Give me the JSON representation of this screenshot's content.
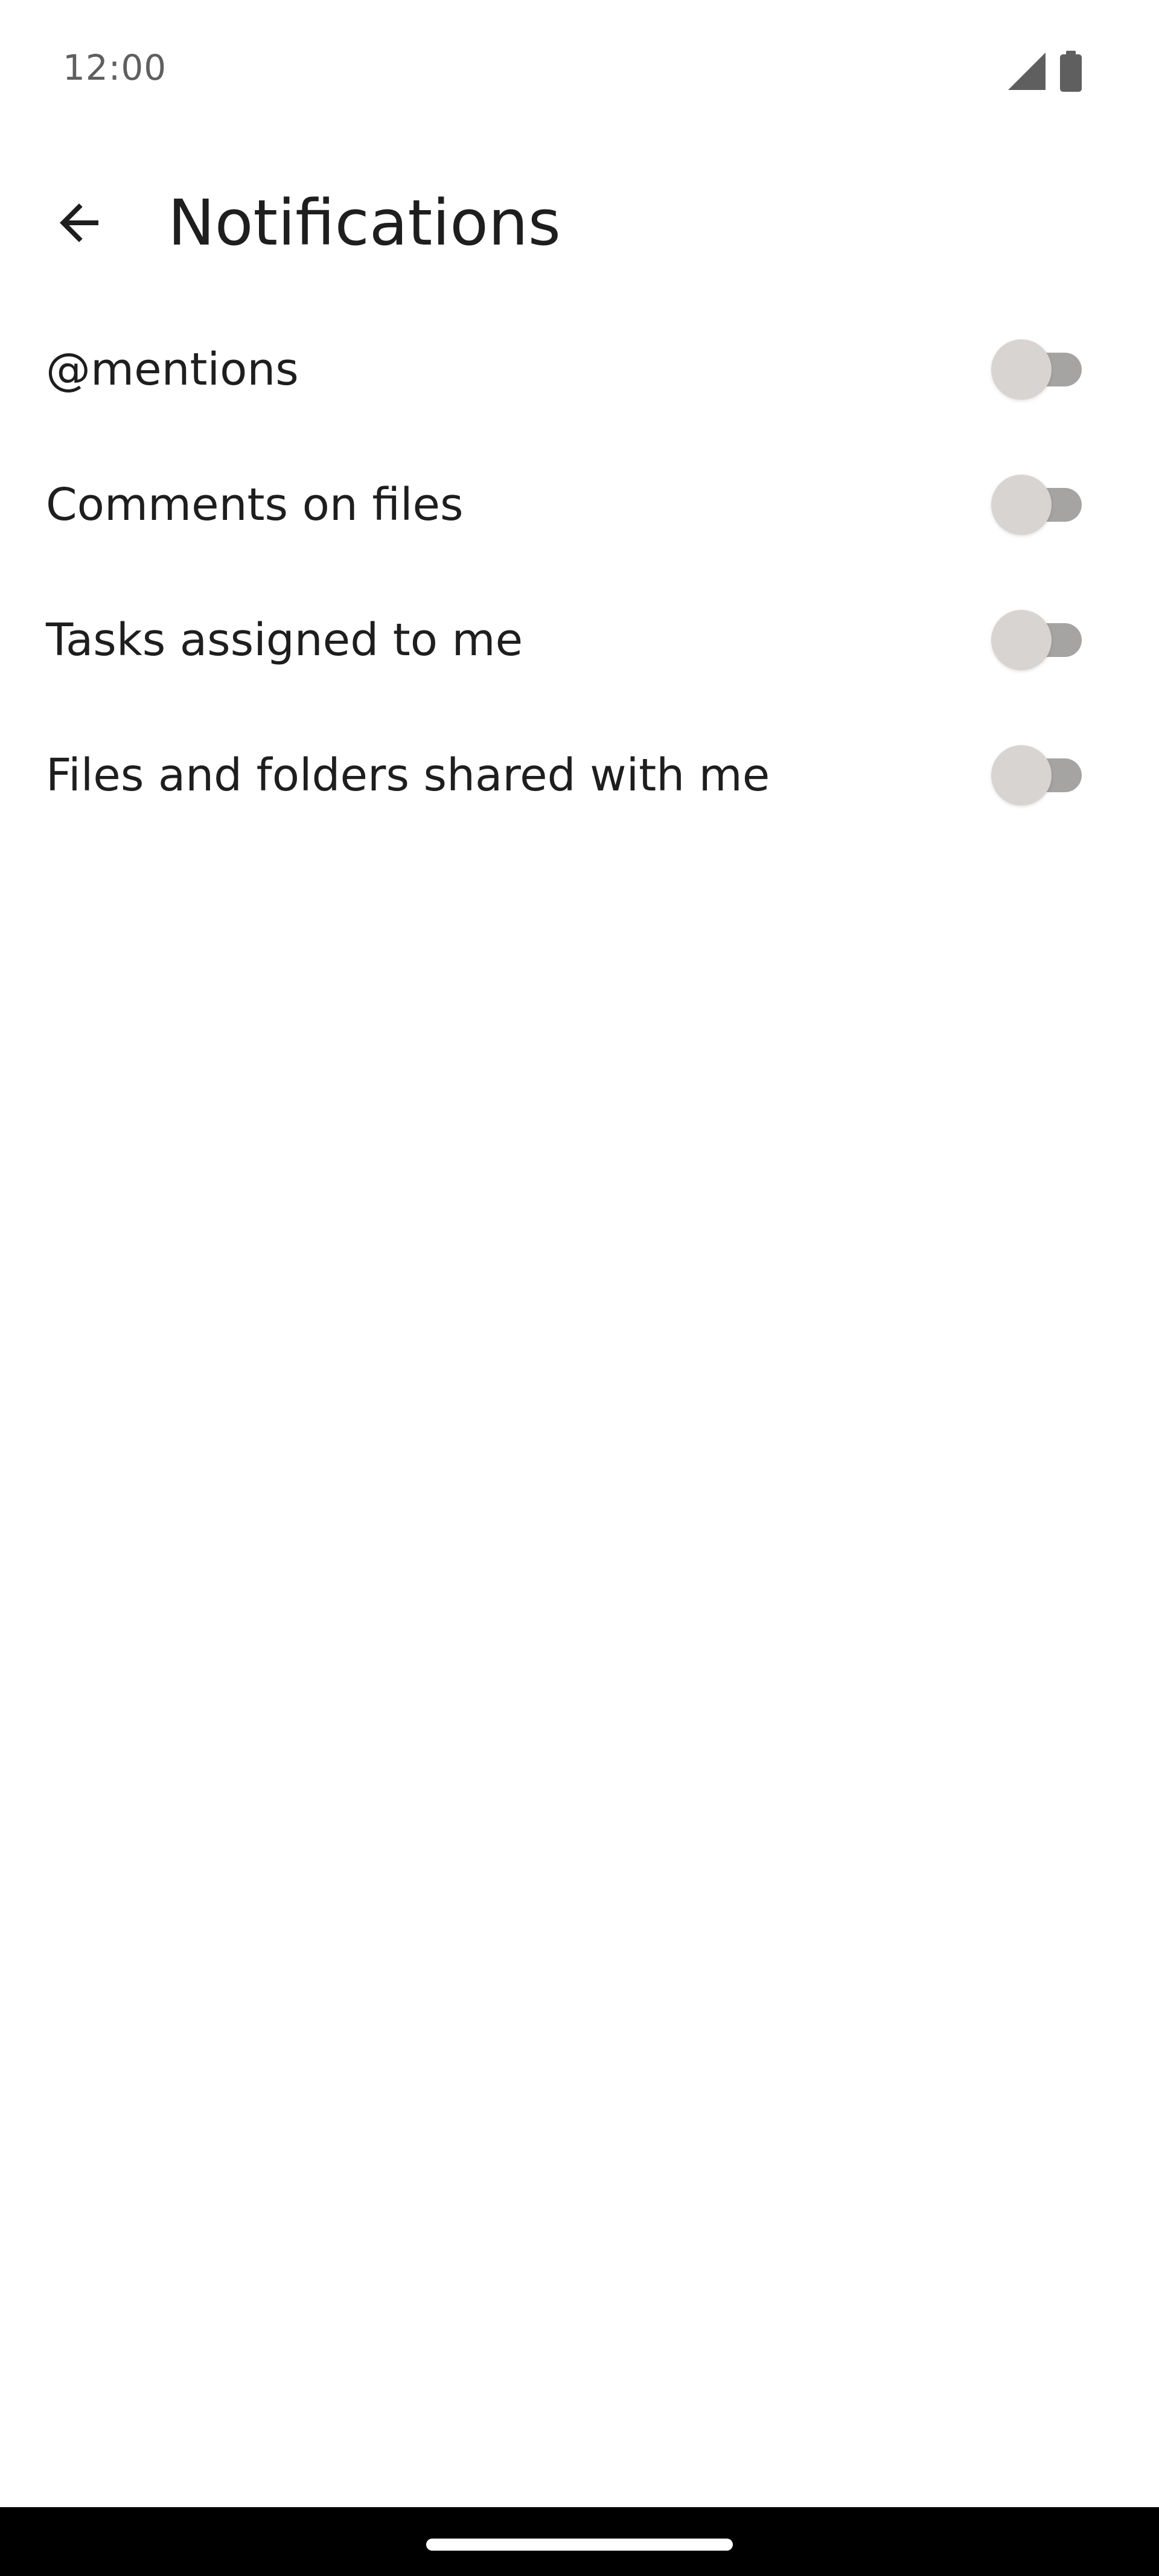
{
  "status_bar": {
    "time": "12:00",
    "icons": [
      "signal-icon",
      "battery-icon"
    ]
  },
  "header": {
    "back_icon": "arrow-left-icon",
    "title": "Notifications"
  },
  "settings": [
    {
      "label": "@mentions",
      "enabled": false
    },
    {
      "label": "Comments on files",
      "enabled": false
    },
    {
      "label": "Tasks assigned to me",
      "enabled": false
    },
    {
      "label": "Files and folders shared with me",
      "enabled": false
    }
  ],
  "colors": {
    "text_primary": "#1e1e1e",
    "status_text": "#5f5f5f",
    "toggle_track_off": "#a5a4a3",
    "toggle_thumb_off": "#d8d4d1",
    "nav_bar": "#000000"
  }
}
